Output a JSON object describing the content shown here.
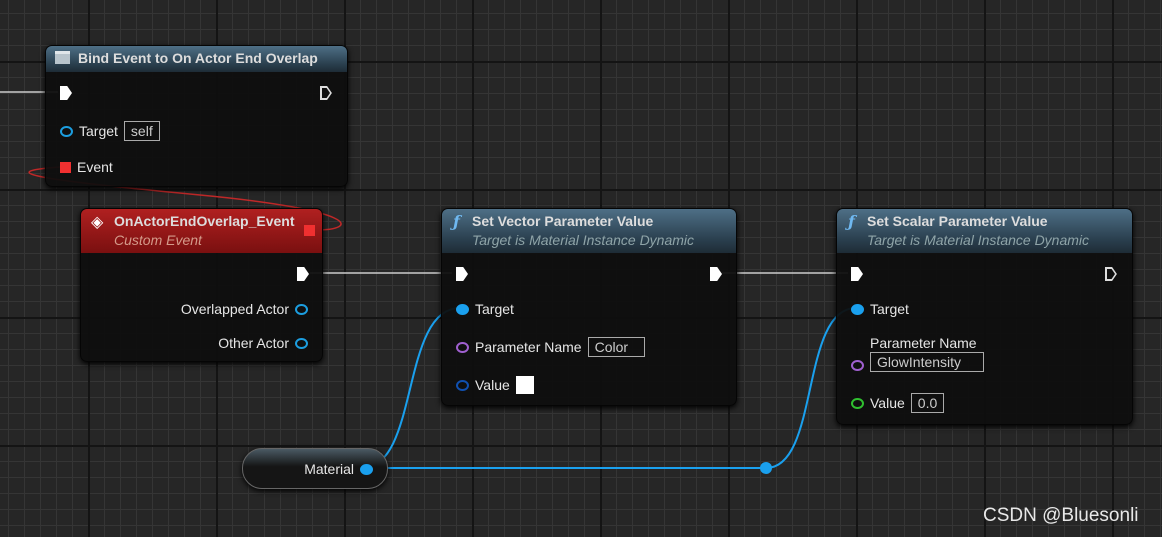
{
  "bind_node": {
    "title": "Bind Event to On Actor End Overlap",
    "target_label": "Target",
    "target_value": "self",
    "event_label": "Event"
  },
  "custom_event": {
    "title": "OnActorEndOverlap_Event",
    "subtitle": "Custom Event",
    "overlapped": "Overlapped Actor",
    "other": "Other Actor"
  },
  "vector_node": {
    "title": "Set Vector Parameter Value",
    "subtitle": "Target is Material Instance Dynamic",
    "target": "Target",
    "param_label": "Parameter Name",
    "param_value": "Color",
    "value_label": "Value",
    "value_color": "#ffffff"
  },
  "scalar_node": {
    "title": "Set Scalar Parameter Value",
    "subtitle": "Target is Material Instance Dynamic",
    "target": "Target",
    "param_label": "Parameter Name",
    "param_value": "GlowIntensity",
    "value_label": "Value",
    "value": "0.0"
  },
  "material_node": {
    "label": "Material"
  },
  "colors": {
    "object_pin": "#1aa0ee",
    "exec": "#ffffff",
    "delegate": "#f03030",
    "name_pin": "#b070e0",
    "float_pin": "#30c030"
  },
  "watermark": "CSDN @Bluesonli"
}
